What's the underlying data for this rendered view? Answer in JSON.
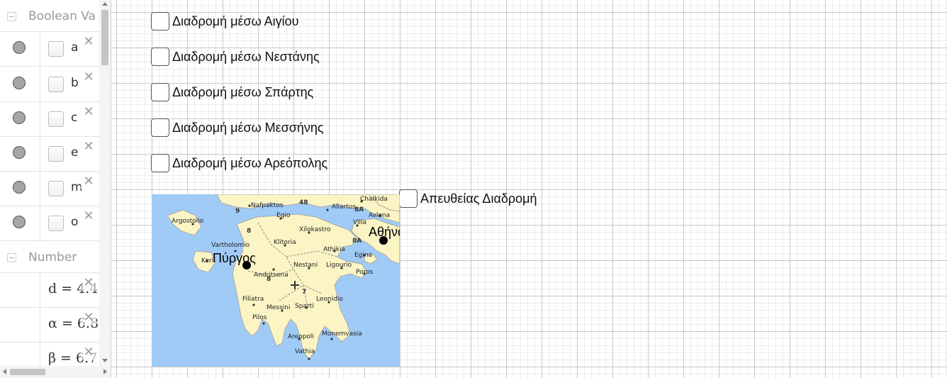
{
  "sidebar": {
    "groups": [
      {
        "title": "Boolean Va",
        "rows": [
          {
            "name": "a"
          },
          {
            "name": "b"
          },
          {
            "name": "c"
          },
          {
            "name": "e"
          },
          {
            "name": "m"
          },
          {
            "name": "o"
          }
        ]
      },
      {
        "title": "Number",
        "rows": [
          {
            "expr": "d = 4.4"
          },
          {
            "expr": "α = 6.8"
          },
          {
            "expr": "β = 6.7"
          }
        ]
      }
    ],
    "delete_glyph": "✕"
  },
  "graphics": {
    "checkboxes": [
      {
        "label": "Διαδρομή μέσω Αιγίου"
      },
      {
        "label": "Διαδρομή μέσω Νεστάνης"
      },
      {
        "label": "Διαδρομή μέσω Σπάρτης"
      },
      {
        "label": "Διαδρομή μέσω Μεσσήνης"
      },
      {
        "label": "Διαδρομή μέσω Αρεόπολης"
      },
      {
        "label": "Απευθείας Διαδρομή"
      }
    ],
    "map": {
      "points": {
        "pyrgos": "Πύργος",
        "athina": "Αθήνα"
      },
      "places": [
        "Nafpaktos",
        "Chalkida",
        "Egio",
        "Aliartos",
        "Avlona",
        "Argostolio",
        "Xilokastro",
        "Vilia",
        "Vartholomio",
        "Klitoria",
        "Athikia",
        "Egina",
        "Keri",
        "Andritsena",
        "Nestani",
        "Ligourio",
        "Poros",
        "Filiatra",
        "Leonidio",
        "Messini",
        "Sparti",
        "Pilos",
        "Areopoli",
        "Monemvasia",
        "Vathia"
      ],
      "road_labels": [
        "9",
        "48",
        "8A",
        "8A",
        "7",
        "8",
        "8"
      ],
      "colors": {
        "sea": "#9fcbf6",
        "land": "#fbf4c4",
        "border": "#a9a9a9"
      }
    }
  }
}
